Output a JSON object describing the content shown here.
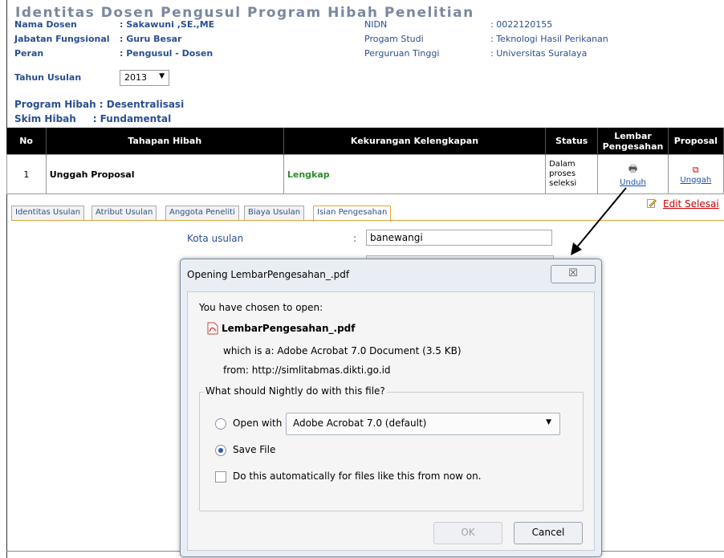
{
  "header": {
    "title": "Identitas Dosen Pengusul Program Hibah Penelitian",
    "left": [
      {
        "label": "Nama Dosen",
        "value": ": Sakawuni ,SE.,ME"
      },
      {
        "label": "Jabatan Fungsional",
        "value": ": Guru Besar"
      },
      {
        "label": "Peran",
        "value": ": Pengusul - Dosen"
      },
      {
        "label": "Tahun Usulan",
        "value": ":"
      }
    ],
    "year": "2013",
    "right": [
      {
        "label": "NIDN",
        "value": ": 0022120155"
      },
      {
        "label": "Progam Studi",
        "value": ": Teknologi Hasil Perikanan"
      },
      {
        "label": "Perguruan Tinggi",
        "value": ": Universitas Suralaya"
      }
    ],
    "program": "Program Hibah : Desentralisasi",
    "skim": "Skim Hibah     : Fundamental"
  },
  "table": {
    "headers": [
      "No",
      "Tahapan Hibah",
      "Kekurangan Kelengkapan",
      "Status",
      "Lembar Pengesahan",
      "Proposal"
    ],
    "row": {
      "no": "1",
      "tahapan": "Unggah Proposal",
      "kekurangan": "Lengkap",
      "status": "Dalam proses seleksi",
      "lembar_link": "Unduh",
      "proposal_link": "Unggah"
    }
  },
  "tabs": [
    "Identitas Usulan",
    "Atribut Usulan",
    "Anggota Peneliti",
    "Biaya Usulan",
    "Isian Pengesahan"
  ],
  "edit_link": "Edit Selesai",
  "form": {
    "kota_label": "Kota usulan",
    "colon": ":",
    "kota_value": "banewangi"
  },
  "dialog": {
    "title": "Opening LembarPengesahan_.pdf",
    "close": "☒",
    "chosen": "You have chosen to open:",
    "filename": "LembarPengesahan_.pdf",
    "which_is": "which is a:  Adobe Acrobat 7.0 Document (3.5 KB)",
    "from": "from:  http://simlitabmas.dikti.go.id",
    "question": "What should Nightly do with this file?",
    "open_with": "Open with",
    "open_with_app": "Adobe Acrobat 7.0 (default)",
    "save_file": "Save File",
    "auto": "Do this automatically for files like this from now on.",
    "ok": "OK",
    "cancel": "Cancel"
  }
}
